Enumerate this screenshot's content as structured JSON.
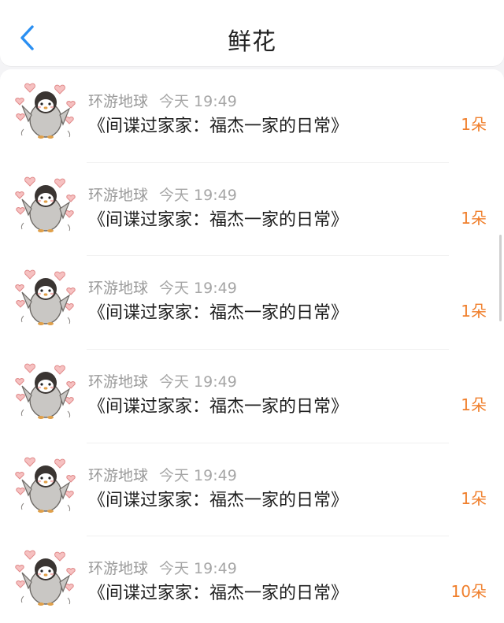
{
  "header": {
    "title": "鲜花"
  },
  "accent_color": "#2a8ff2",
  "count_color": "#f07f2c",
  "items": [
    {
      "user": "环游地球",
      "time": "今天 19:49",
      "book": "《间谍过家家：福杰一家的日常》",
      "count": "1朵"
    },
    {
      "user": "环游地球",
      "time": "今天 19:49",
      "book": "《间谍过家家：福杰一家的日常》",
      "count": "1朵"
    },
    {
      "user": "环游地球",
      "time": "今天 19:49",
      "book": "《间谍过家家：福杰一家的日常》",
      "count": "1朵"
    },
    {
      "user": "环游地球",
      "time": "今天 19:49",
      "book": "《间谍过家家：福杰一家的日常》",
      "count": "1朵"
    },
    {
      "user": "环游地球",
      "time": "今天 19:49",
      "book": "《间谍过家家：福杰一家的日常》",
      "count": "1朵"
    },
    {
      "user": "环游地球",
      "time": "今天 19:49",
      "book": "《间谍过家家：福杰一家的日常》",
      "count": "10朵"
    }
  ]
}
